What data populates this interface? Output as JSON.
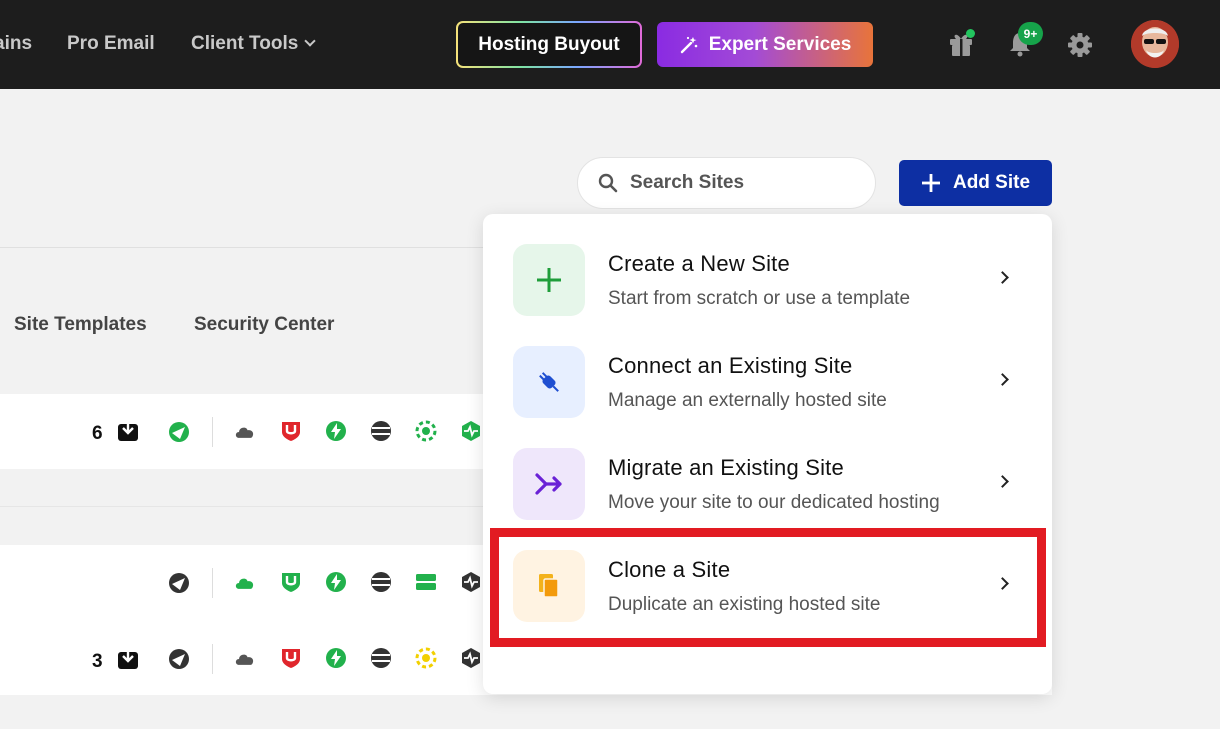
{
  "nav": {
    "domains_clipped": "ains",
    "pro_email": "Pro Email",
    "client_tools": "Client Tools",
    "hosting_buyout": "Hosting Buyout",
    "expert_services": "Expert Services",
    "notification_count": "9+"
  },
  "toolbar": {
    "search_placeholder": "Search Sites",
    "add_site": "Add Site"
  },
  "tabs": [
    "Site Templates",
    "Security Center"
  ],
  "rows": [
    {
      "count": "6"
    },
    {
      "count": ""
    },
    {
      "count": "3"
    }
  ],
  "add_menu": {
    "items": [
      {
        "title": "Create a New Site",
        "subtitle": "Start from scratch or use a template"
      },
      {
        "title": "Connect an Existing Site",
        "subtitle": "Manage an externally hosted site"
      },
      {
        "title": "Migrate an Existing Site",
        "subtitle": "Move your site to our dedicated hosting"
      },
      {
        "title": "Clone a Site",
        "subtitle": "Duplicate an existing hosted site"
      }
    ]
  },
  "colors": {
    "topbar": "#1d1d1d",
    "primary": "#0d2fa3",
    "highlight": "#e21b22",
    "status_green": "#22b14c"
  }
}
